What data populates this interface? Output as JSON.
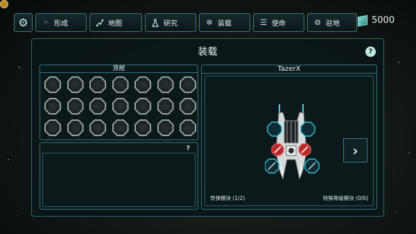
{
  "top_nav": {
    "settings": "gear-icon",
    "buttons": [
      {
        "label": "形成",
        "icon": "formation-icon"
      },
      {
        "label": "地图",
        "icon": "map-icon"
      },
      {
        "label": "研究",
        "icon": "flask-icon"
      },
      {
        "label": "装载",
        "icon": "loadout-icon"
      },
      {
        "label": "使命",
        "icon": "mission-list-icon"
      },
      {
        "label": "驻地",
        "icon": "base-icon"
      }
    ],
    "currency": {
      "amount": "5000",
      "icon": "cube-icon"
    }
  },
  "panel": {
    "title": "装载",
    "help": "?"
  },
  "cargo": {
    "title": "货舱",
    "slot_count": 21,
    "columns": 7
  },
  "info": {
    "help": "?"
  },
  "ship": {
    "name": "TazerX",
    "missile_modules": "导弹模块 (1/2)",
    "special_modules": "特殊等级模块 (0/0)",
    "next_icon": "chevron-right-icon"
  },
  "colors": {
    "accent": "#35767a",
    "panel_bg": "#0c1a1c",
    "text": "#e0f3f3",
    "slot_blue": "#2ec7e0",
    "slot_red": "#d43a3a"
  }
}
